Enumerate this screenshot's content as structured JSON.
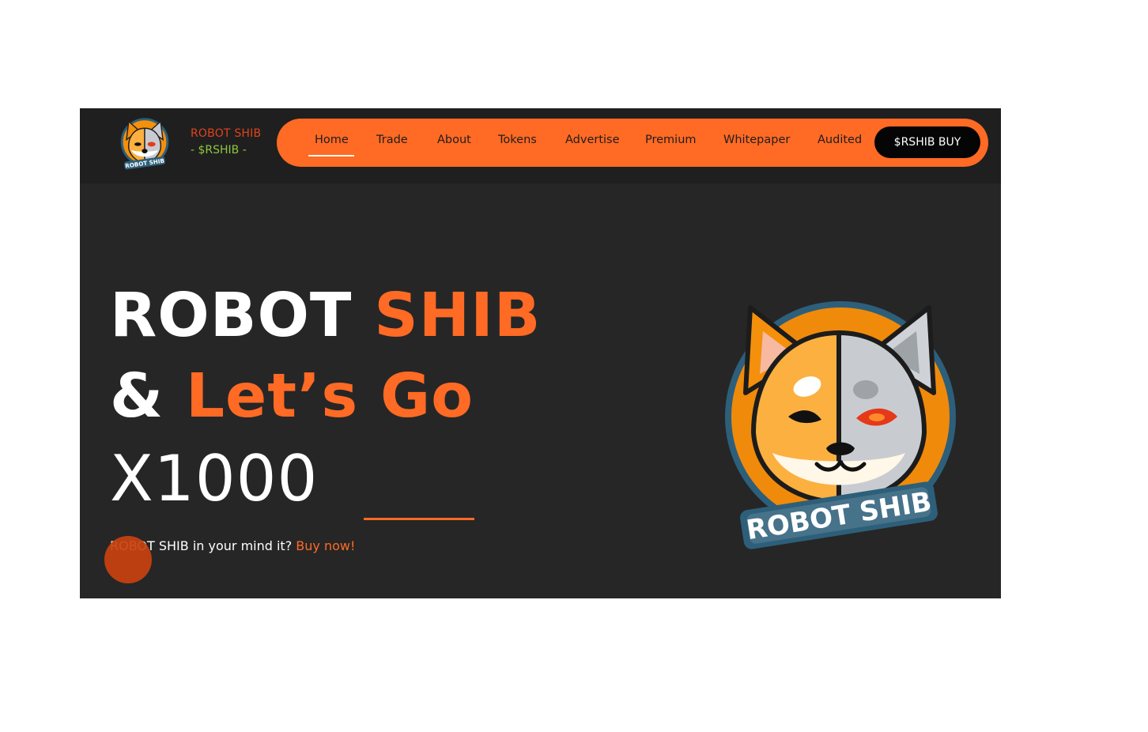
{
  "brand": {
    "name": "ROBOT SHIB",
    "ticker": "- $RSHIB -",
    "logo_text": "ROBOT SHIB"
  },
  "nav": {
    "items": [
      {
        "label": "Home"
      },
      {
        "label": "Trade"
      },
      {
        "label": "About"
      },
      {
        "label": "Tokens"
      },
      {
        "label": "Advertise"
      },
      {
        "label": "Premium"
      },
      {
        "label": "Whitepaper"
      },
      {
        "label": "Audited"
      }
    ],
    "active": "Home",
    "buy_label": "$RSHIB BUY"
  },
  "hero": {
    "line1_white": "ROBOT ",
    "line1_accent": "SHIB",
    "line2_white": "& ",
    "line2_accent": "Let’s Go",
    "line3": "X1000",
    "tagline": "ROBOT SHIB in your mind it? ",
    "tagline_link": "Buy now!"
  },
  "mascot": {
    "label": "ROBOT SHIB"
  },
  "colors": {
    "accent": "#ff6a24",
    "background": "#262626",
    "header": "#1f1f1f",
    "brand_red": "#e0431c",
    "brand_green": "#8ec63f"
  }
}
